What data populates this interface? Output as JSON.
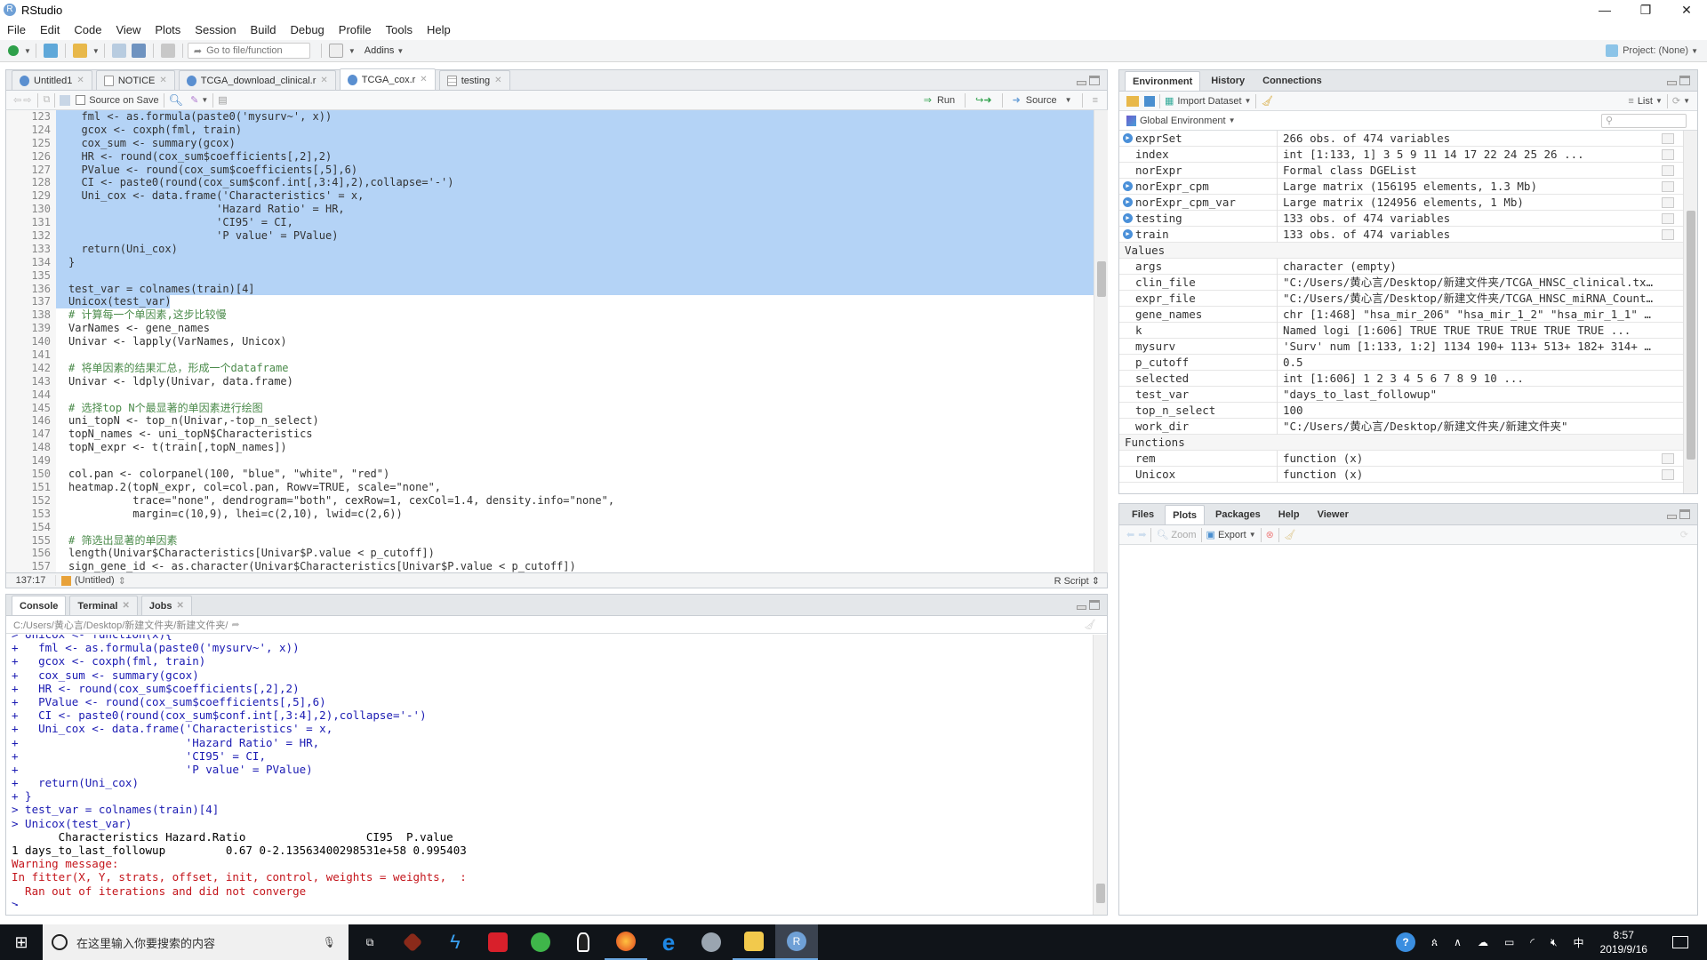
{
  "window": {
    "title": "RStudio",
    "app_icon": "R",
    "controls": [
      "minimize",
      "restore",
      "close"
    ]
  },
  "menu": [
    "File",
    "Edit",
    "Code",
    "View",
    "Plots",
    "Session",
    "Build",
    "Debug",
    "Profile",
    "Tools",
    "Help"
  ],
  "toolbar": {
    "goto_placeholder": "Go to file/function",
    "addins": "Addins",
    "project": "Project: (None)"
  },
  "editor": {
    "tabs": [
      {
        "label": "Untitled1",
        "active": false
      },
      {
        "label": "NOTICE",
        "active": false
      },
      {
        "label": "TCGA_download_clinical.r",
        "active": false
      },
      {
        "label": "TCGA_cox.r",
        "active": true
      },
      {
        "label": "testing",
        "active": false
      }
    ],
    "source_on_save": "Source on Save",
    "run": "Run",
    "source": "Source",
    "lines": [
      {
        "n": "123",
        "t": "  fml <- as.formula(paste0('mysurv~', x))",
        "sel": true
      },
      {
        "n": "124",
        "t": "  gcox <- coxph(fml, train)",
        "sel": true
      },
      {
        "n": "125",
        "t": "  cox_sum <- summary(gcox)",
        "sel": true
      },
      {
        "n": "126",
        "t": "  HR <- round(cox_sum$coefficients[,2],2)",
        "sel": true
      },
      {
        "n": "127",
        "t": "  PValue <- round(cox_sum$coefficients[,5],6)",
        "sel": true
      },
      {
        "n": "128",
        "t": "  CI <- paste0(round(cox_sum$conf.int[,3:4],2),collapse='-')",
        "sel": true
      },
      {
        "n": "129",
        "t": "  Uni_cox <- data.frame('Characteristics' = x,",
        "sel": true
      },
      {
        "n": "130",
        "t": "                       'Hazard Ratio' = HR,",
        "sel": true
      },
      {
        "n": "131",
        "t": "                       'CI95' = CI,",
        "sel": true
      },
      {
        "n": "132",
        "t": "                       'P value' = PValue)",
        "sel": true
      },
      {
        "n": "133",
        "t": "  return(Uni_cox)",
        "sel": true
      },
      {
        "n": "134",
        "t": "}",
        "sel": true
      },
      {
        "n": "135",
        "t": "",
        "sel": true
      },
      {
        "n": "136",
        "t": "test_var = colnames(train)[4]",
        "sel": true
      },
      {
        "n": "137",
        "t": "Unicox(test_var)",
        "sel": "partial"
      },
      {
        "n": "138",
        "t": "# 计算每一个单因素,这步比较慢",
        "sel": false,
        "cmt": true
      },
      {
        "n": "139",
        "t": "VarNames <- gene_names",
        "sel": false
      },
      {
        "n": "140",
        "t": "Univar <- lapply(VarNames, Unicox)",
        "sel": false
      },
      {
        "n": "141",
        "t": "",
        "sel": false
      },
      {
        "n": "142",
        "t": "# 将单因素的结果汇总，形成一个dataframe",
        "sel": false,
        "cmt": true
      },
      {
        "n": "143",
        "t": "Univar <- ldply(Univar, data.frame)",
        "sel": false
      },
      {
        "n": "144",
        "t": "",
        "sel": false
      },
      {
        "n": "145",
        "t": "# 选择top N个最显著的单因素进行绘图",
        "sel": false,
        "cmt": true
      },
      {
        "n": "146",
        "t": "uni_topN <- top_n(Univar,-top_n_select)",
        "sel": false
      },
      {
        "n": "147",
        "t": "topN_names <- uni_topN$Characteristics",
        "sel": false
      },
      {
        "n": "148",
        "t": "topN_expr <- t(train[,topN_names])",
        "sel": false
      },
      {
        "n": "149",
        "t": "",
        "sel": false
      },
      {
        "n": "150",
        "t": "col.pan <- colorpanel(100, \"blue\", \"white\", \"red\")",
        "sel": false
      },
      {
        "n": "151",
        "t": "heatmap.2(topN_expr, col=col.pan, Rowv=TRUE, scale=\"none\",",
        "sel": false
      },
      {
        "n": "152",
        "t": "          trace=\"none\", dendrogram=\"both\", cexRow=1, cexCol=1.4, density.info=\"none\",",
        "sel": false
      },
      {
        "n": "153",
        "t": "          margin=c(10,9), lhei=c(2,10), lwid=c(2,6))",
        "sel": false
      },
      {
        "n": "154",
        "t": "",
        "sel": false
      },
      {
        "n": "155",
        "t": "# 筛选出显著的单因素",
        "sel": false,
        "cmt": true
      },
      {
        "n": "156",
        "t": "length(Univar$Characteristics[Univar$P.value < p_cutoff])",
        "sel": false
      },
      {
        "n": "157",
        "t": "sign_gene_id <- as.character(Univar$Characteristics[Univar$P.value < p_cutoff])",
        "sel": false
      }
    ],
    "status": {
      "position": "137:17",
      "scope": "(Untitled)",
      "filetype": "R Script"
    }
  },
  "console": {
    "tabs": [
      "Console",
      "Terminal",
      "Jobs"
    ],
    "path": "C:/Users/黄心言/Desktop/新建文件夹/新建文件夹/",
    "lines": [
      {
        "t": "> Unicox <- function(x){",
        "k": "in"
      },
      {
        "t": "+   fml <- as.formula(paste0('mysurv~', x))",
        "k": "in"
      },
      {
        "t": "+   gcox <- coxph(fml, train)",
        "k": "in"
      },
      {
        "t": "+   cox_sum <- summary(gcox)",
        "k": "in"
      },
      {
        "t": "+   HR <- round(cox_sum$coefficients[,2],2)",
        "k": "in"
      },
      {
        "t": "+   PValue <- round(cox_sum$coefficients[,5],6)",
        "k": "in"
      },
      {
        "t": "+   CI <- paste0(round(cox_sum$conf.int[,3:4],2),collapse='-')",
        "k": "in"
      },
      {
        "t": "+   Uni_cox <- data.frame('Characteristics' = x,",
        "k": "in"
      },
      {
        "t": "+                         'Hazard Ratio' = HR,",
        "k": "in"
      },
      {
        "t": "+                         'CI95' = CI,",
        "k": "in"
      },
      {
        "t": "+                         'P value' = PValue)",
        "k": "in"
      },
      {
        "t": "+   return(Uni_cox)",
        "k": "in"
      },
      {
        "t": "+ }",
        "k": "in"
      },
      {
        "t": "> test_var = colnames(train)[4]",
        "k": "in"
      },
      {
        "t": "> Unicox(test_var)",
        "k": "in"
      },
      {
        "t": "       Characteristics Hazard.Ratio                  CI95  P.value",
        "k": "out"
      },
      {
        "t": "1 days_to_last_followup         0.67 0-2.13563400298531e+58 0.995403",
        "k": "out"
      },
      {
        "t": "Warning message:",
        "k": "err"
      },
      {
        "t": "In fitter(X, Y, strats, offset, init, control, weights = weights,  :",
        "k": "err"
      },
      {
        "t": "  Ran out of iterations and did not converge",
        "k": "err"
      },
      {
        "t": ">",
        "k": "in"
      }
    ]
  },
  "environment": {
    "tabs": [
      "Environment",
      "History",
      "Connections"
    ],
    "import_dataset": "Import Dataset",
    "view_mode": "List",
    "scope": "Global Environment",
    "search_placeholder": "",
    "data": [
      {
        "name": "exprSet",
        "value": "266 obs. of 474 variables",
        "expand": true,
        "icon": "grid"
      },
      {
        "name": "index",
        "value": "int [1:133, 1] 3 5 9 11 14 17 22 24 25 26 ...",
        "expand": false,
        "icon": "grid"
      },
      {
        "name": "norExpr",
        "value": "Formal class DGEList",
        "expand": false,
        "icon": "search"
      },
      {
        "name": "norExpr_cpm",
        "value": "Large matrix (156195 elements, 1.3 Mb)",
        "expand": true,
        "icon": "grid"
      },
      {
        "name": "norExpr_cpm_var",
        "value": "Large matrix (124956 elements, 1 Mb)",
        "expand": true,
        "icon": "grid"
      },
      {
        "name": "testing",
        "value": "133 obs. of 474 variables",
        "expand": true,
        "icon": "grid"
      },
      {
        "name": "train",
        "value": "133 obs. of 474 variables",
        "expand": true,
        "icon": "grid"
      }
    ],
    "values_header": "Values",
    "values": [
      {
        "name": "args",
        "value": "character (empty)"
      },
      {
        "name": "clin_file",
        "value": "\"C:/Users/黄心言/Desktop/新建文件夹/TCGA_HNSC_clinical.tx…"
      },
      {
        "name": "expr_file",
        "value": "\"C:/Users/黄心言/Desktop/新建文件夹/TCGA_HNSC_miRNA_Count…"
      },
      {
        "name": "gene_names",
        "value": "chr [1:468] \"hsa_mir_206\" \"hsa_mir_1_2\" \"hsa_mir_1_1\" …"
      },
      {
        "name": "k",
        "value": "Named logi [1:606] TRUE TRUE TRUE TRUE TRUE TRUE ..."
      },
      {
        "name": "mysurv",
        "value": "'Surv' num [1:133, 1:2] 1134 190+ 113+ 513+ 182+ 314+ …"
      },
      {
        "name": "p_cutoff",
        "value": "0.5"
      },
      {
        "name": "selected",
        "value": "int [1:606] 1 2 3 4 5 6 7 8 9 10 ..."
      },
      {
        "name": "test_var",
        "value": "\"days_to_last_followup\""
      },
      {
        "name": "top_n_select",
        "value": "100"
      },
      {
        "name": "work_dir",
        "value": "\"C:/Users/黄心言/Desktop/新建文件夹/新建文件夹\""
      }
    ],
    "functions_header": "Functions",
    "functions": [
      {
        "name": "rem",
        "value": "function (x)"
      },
      {
        "name": "Unicox",
        "value": "function (x)"
      }
    ]
  },
  "files_pane": {
    "tabs": [
      "Files",
      "Plots",
      "Packages",
      "Help",
      "Viewer"
    ],
    "active_tab": "Plots",
    "zoom": "Zoom",
    "export": "Export"
  },
  "taskbar": {
    "search_placeholder": "在这里输入你要搜索的内容",
    "apps": [
      "task-view",
      "game-app",
      "visual-studio",
      "netease-music",
      "wechat",
      "qq",
      "firefox",
      "edge",
      "rstudio-desktop",
      "file-explorer",
      "rstudio"
    ],
    "time": "8:57",
    "date": "2019/9/16",
    "ime": "中"
  }
}
